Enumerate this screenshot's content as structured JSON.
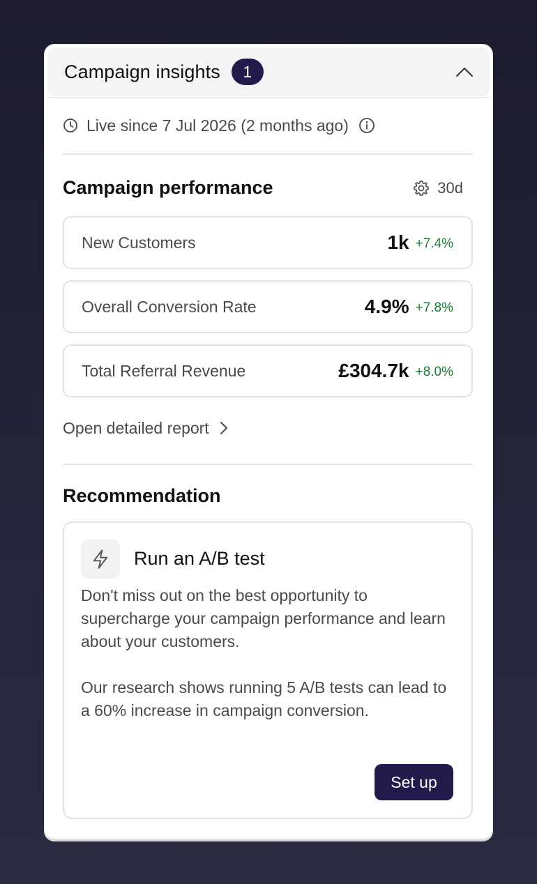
{
  "header": {
    "title": "Campaign insights",
    "badge_count": "1",
    "collapse_icon": "chevron-up-icon"
  },
  "live": {
    "text": "Live since 7 Jul 2026 (2 months ago)",
    "clock_icon": "clock-icon",
    "info_icon": "info-icon"
  },
  "performance": {
    "title": "Campaign performance",
    "period_label": "30d",
    "settings_icon": "gear-icon",
    "metrics": [
      {
        "label": "New Customers",
        "value": "1k",
        "change": "+7.4%"
      },
      {
        "label": "Overall Conversion Rate",
        "value": "4.9%",
        "change": "+7.8%"
      },
      {
        "label": "Total Referral Revenue",
        "value": "£304.7k",
        "change": "+8.0%"
      }
    ],
    "report_link": "Open detailed report",
    "positive_color": "#1e7a36"
  },
  "recommendation": {
    "section_title": "Recommendation",
    "icon": "lightning-bolt-icon",
    "title": "Run an A/B test",
    "body_1": "Don't miss out on the best opportunity to supercharge your campaign performance and learn about your customers.",
    "body_2": "Our research shows running 5 A/B tests can lead to a 60% increase in campaign conversion.",
    "button_label": "Set up"
  },
  "colors": {
    "accent": "#211a4a",
    "background": "#1c1c2e"
  }
}
